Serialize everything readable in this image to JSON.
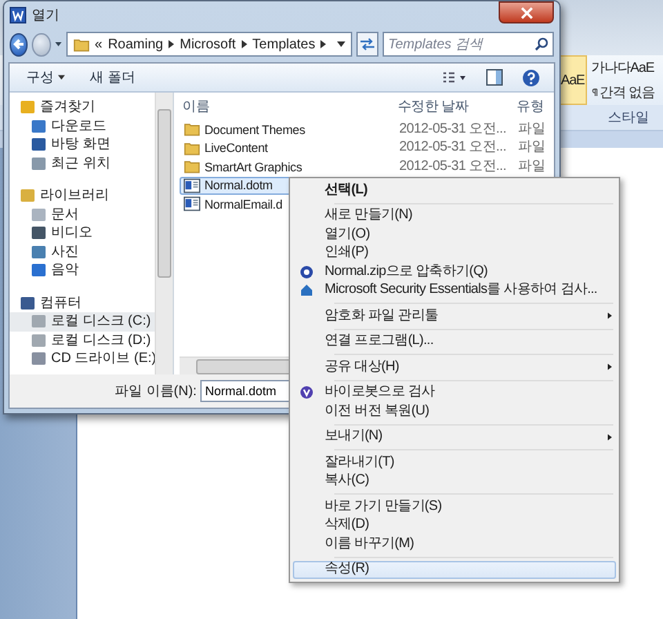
{
  "background_app": {
    "styles": [
      {
        "sample": "AaE"
      },
      {
        "sample": "가나다AaE",
        "name": "간격 없음"
      }
    ],
    "group_label": "스타일"
  },
  "dialog": {
    "title": "열기",
    "address": {
      "crumbs": [
        "Roaming",
        "Microsoft",
        "Templates"
      ],
      "overflow": "«"
    },
    "search": {
      "placeholder": "Templates 검색"
    },
    "toolbar": [
      {
        "label": "구성",
        "dropdown": true
      },
      {
        "label": "새 폴더",
        "dropdown": false
      }
    ],
    "nav": [
      {
        "label": "즐겨찾기",
        "children": [
          {
            "label": "다운로드",
            "selected": false
          },
          {
            "label": "바탕 화면",
            "selected": false
          },
          {
            "label": "최근 위치",
            "selected": false
          }
        ]
      },
      {
        "label": "라이브러리",
        "children": [
          {
            "label": "문서",
            "selected": false
          },
          {
            "label": "비디오",
            "selected": false
          },
          {
            "label": "사진",
            "selected": false
          },
          {
            "label": "음악",
            "selected": false
          }
        ]
      },
      {
        "label": "컴퓨터",
        "children": [
          {
            "label": "로컬 디스크 (C:)",
            "selected": true
          },
          {
            "label": "로컬 디스크 (D:)",
            "selected": false
          },
          {
            "label": "CD 드라이브 (E:)",
            "selected": false
          }
        ]
      }
    ],
    "columns": [
      "이름",
      "수정한 날짜",
      "유형"
    ],
    "rows": [
      {
        "kind": "folder",
        "name": "Document Themes",
        "date": "2012-05-31 오전...",
        "type": "파일",
        "selected": false
      },
      {
        "kind": "folder",
        "name": "LiveContent",
        "date": "2012-05-31 오전...",
        "type": "파일",
        "selected": false
      },
      {
        "kind": "folder",
        "name": "SmartArt Graphics",
        "date": "2012-05-31 오전...",
        "type": "파일",
        "selected": false
      },
      {
        "kind": "word",
        "name": "Normal.dotm",
        "selected": true
      },
      {
        "kind": "word",
        "name": "NormalEmail.d",
        "selected": false
      }
    ],
    "filename_label": "파일 이름(N):",
    "filename_value": "Normal.dotm"
  },
  "context_menu": [
    {
      "kind": "item",
      "label": "선택(L)",
      "default": true,
      "submenu": false,
      "selected": false
    },
    {
      "kind": "separator"
    },
    {
      "kind": "item",
      "label": "새로 만들기(N)",
      "default": false,
      "submenu": false,
      "selected": false
    },
    {
      "kind": "item",
      "label": "열기(O)",
      "default": false,
      "submenu": false,
      "selected": false
    },
    {
      "kind": "item",
      "label": "인쇄(P)",
      "default": false,
      "submenu": false,
      "selected": false
    },
    {
      "kind": "item",
      "label": "Normal.zip으로 압축하기(Q)",
      "default": false,
      "submenu": false,
      "selected": false
    },
    {
      "kind": "item",
      "label": "Microsoft Security Essentials를 사용하여 검사...",
      "default": false,
      "submenu": false,
      "selected": false
    },
    {
      "kind": "separator"
    },
    {
      "kind": "item",
      "label": "암호화 파일 관리툴",
      "default": false,
      "submenu": true,
      "selected": false
    },
    {
      "kind": "separator"
    },
    {
      "kind": "item",
      "label": "연결 프로그램(L)...",
      "default": false,
      "submenu": false,
      "selected": false
    },
    {
      "kind": "separator"
    },
    {
      "kind": "item",
      "label": "공유 대상(H)",
      "default": false,
      "submenu": true,
      "selected": false
    },
    {
      "kind": "separator"
    },
    {
      "kind": "item",
      "label": "바이로봇으로 검사",
      "default": false,
      "submenu": false,
      "selected": false
    },
    {
      "kind": "item",
      "label": "이전 버전 복원(U)",
      "default": false,
      "submenu": false,
      "selected": false
    },
    {
      "kind": "separator"
    },
    {
      "kind": "item",
      "label": "보내기(N)",
      "default": false,
      "submenu": true,
      "selected": false
    },
    {
      "kind": "separator"
    },
    {
      "kind": "item",
      "label": "잘라내기(T)",
      "default": false,
      "submenu": false,
      "selected": false
    },
    {
      "kind": "item",
      "label": "복사(C)",
      "default": false,
      "submenu": false,
      "selected": false
    },
    {
      "kind": "separator"
    },
    {
      "kind": "item",
      "label": "바로 가기 만들기(S)",
      "default": false,
      "submenu": false,
      "selected": false
    },
    {
      "kind": "item",
      "label": "삭제(D)",
      "default": false,
      "submenu": false,
      "selected": false
    },
    {
      "kind": "item",
      "label": "이름 바꾸기(M)",
      "default": false,
      "submenu": false,
      "selected": false
    },
    {
      "kind": "separator"
    },
    {
      "kind": "item",
      "label": "속성(R)",
      "default": false,
      "submenu": false,
      "selected": true
    }
  ]
}
